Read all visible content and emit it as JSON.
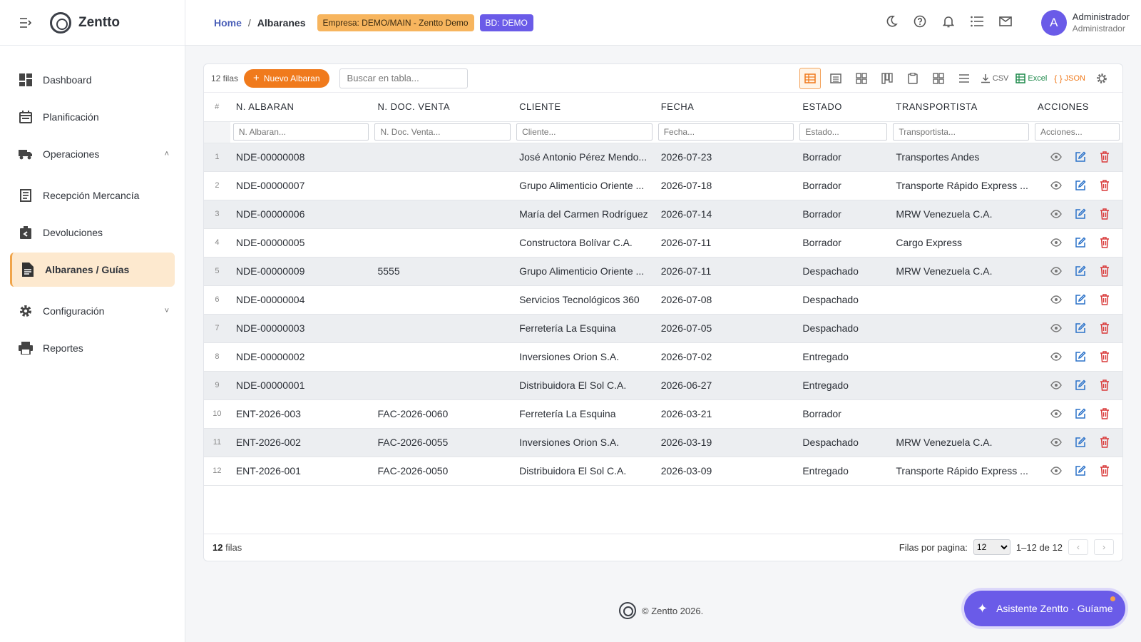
{
  "sidebar": {
    "brand": "Zentto",
    "items": [
      {
        "label": "Dashboard",
        "icon": "dashboard-icon"
      },
      {
        "label": "Planificación",
        "icon": "calendar-icon"
      },
      {
        "label": "Operaciones",
        "icon": "truck-icon",
        "expandable": true
      },
      {
        "label": "Recepción Mercancía",
        "icon": "receipt-icon"
      },
      {
        "label": "Devoluciones",
        "icon": "return-icon"
      },
      {
        "label": "Albaranes / Guías",
        "icon": "document-icon",
        "active": true
      },
      {
        "label": "Configuración",
        "icon": "gear-icon",
        "expandable": true
      },
      {
        "label": "Reportes",
        "icon": "printer-icon"
      }
    ]
  },
  "header": {
    "breadcrumb_home": "Home",
    "breadcrumb_sep": "/",
    "breadcrumb_current": "Albaranes",
    "empresa_badge": "Empresa: DEMO/MAIN - Zentto Demo",
    "bd_badge": "BD: DEMO",
    "user_name": "Administrador",
    "user_role": "Administrador",
    "avatar_letter": "A"
  },
  "toolbar": {
    "row_count": "12 filas",
    "new_button": "Nuevo Albaran",
    "search_placeholder": "Buscar en tabla...",
    "csv_label": "CSV",
    "excel_label": "Excel",
    "json_label": "JSON"
  },
  "table": {
    "columns": [
      "#",
      "N. ALBARAN",
      "N. DOC. VENTA",
      "CLIENTE",
      "FECHA",
      "ESTADO",
      "TRANSPORTISTA",
      "ACCIONES"
    ],
    "filters": [
      "N. Albaran...",
      "N. Doc. Venta...",
      "Cliente...",
      "Fecha...",
      "Estado...",
      "Transportista...",
      "Acciones..."
    ],
    "rows": [
      {
        "n": "1",
        "albaran": "NDE-00000008",
        "doc": "",
        "cliente": "José Antonio Pérez Mendo...",
        "fecha": "2026-07-23",
        "estado": "Borrador",
        "transportista": "Transportes Andes"
      },
      {
        "n": "2",
        "albaran": "NDE-00000007",
        "doc": "",
        "cliente": "Grupo Alimenticio Oriente ...",
        "fecha": "2026-07-18",
        "estado": "Borrador",
        "transportista": "Transporte Rápido Express ..."
      },
      {
        "n": "3",
        "albaran": "NDE-00000006",
        "doc": "",
        "cliente": "María del Carmen Rodríguez",
        "fecha": "2026-07-14",
        "estado": "Borrador",
        "transportista": "MRW Venezuela C.A."
      },
      {
        "n": "4",
        "albaran": "NDE-00000005",
        "doc": "",
        "cliente": "Constructora Bolívar C.A.",
        "fecha": "2026-07-11",
        "estado": "Borrador",
        "transportista": "Cargo Express"
      },
      {
        "n": "5",
        "albaran": "NDE-00000009",
        "doc": "5555",
        "cliente": "Grupo Alimenticio Oriente ...",
        "fecha": "2026-07-11",
        "estado": "Despachado",
        "transportista": "MRW Venezuela C.A."
      },
      {
        "n": "6",
        "albaran": "NDE-00000004",
        "doc": "",
        "cliente": "Servicios Tecnológicos 360",
        "fecha": "2026-07-08",
        "estado": "Despachado",
        "transportista": ""
      },
      {
        "n": "7",
        "albaran": "NDE-00000003",
        "doc": "",
        "cliente": "Ferretería La Esquina",
        "fecha": "2026-07-05",
        "estado": "Despachado",
        "transportista": ""
      },
      {
        "n": "8",
        "albaran": "NDE-00000002",
        "doc": "",
        "cliente": "Inversiones Orion S.A.",
        "fecha": "2026-07-02",
        "estado": "Entregado",
        "transportista": ""
      },
      {
        "n": "9",
        "albaran": "NDE-00000001",
        "doc": "",
        "cliente": "Distribuidora El Sol C.A.",
        "fecha": "2026-06-27",
        "estado": "Entregado",
        "transportista": ""
      },
      {
        "n": "10",
        "albaran": "ENT-2026-003",
        "doc": "FAC-2026-0060",
        "cliente": "Ferretería La Esquina",
        "fecha": "2026-03-21",
        "estado": "Borrador",
        "transportista": ""
      },
      {
        "n": "11",
        "albaran": "ENT-2026-002",
        "doc": "FAC-2026-0055",
        "cliente": "Inversiones Orion S.A.",
        "fecha": "2026-03-19",
        "estado": "Despachado",
        "transportista": "MRW Venezuela C.A."
      },
      {
        "n": "12",
        "albaran": "ENT-2026-001",
        "doc": "FAC-2026-0050",
        "cliente": "Distribuidora El Sol C.A.",
        "fecha": "2026-03-09",
        "estado": "Entregado",
        "transportista": "Transporte Rápido Express ..."
      }
    ]
  },
  "footer": {
    "count_number": "12",
    "count_label": "filas",
    "rows_per_page_label": "Filas por pagina:",
    "rows_per_page_value": "12",
    "range": "1–12 de 12"
  },
  "copyright": "© Zentto 2026.",
  "assistant_button": "Asistente Zentto · Guíame",
  "colors": {
    "accent_orange": "#f07a1c",
    "accent_purple": "#6a5be8",
    "active_nav_bg": "#fde9cf",
    "delete_red": "#d93a3a",
    "edit_blue": "#2b72c9"
  }
}
